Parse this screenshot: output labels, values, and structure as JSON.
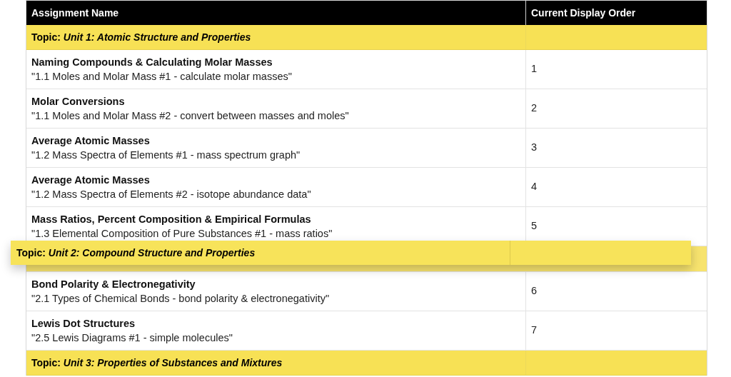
{
  "table": {
    "columns": [
      {
        "label": "Assignment Name"
      },
      {
        "label": "Current Display Order"
      }
    ],
    "rows": [
      {
        "kind": "topic",
        "text": "Topic: *Unit 1: Atomic Structure and Properties*"
      },
      {
        "kind": "assignment",
        "title": "Naming Compounds & Calculating Molar Masses",
        "subtitle": "\"1.1 Moles and Molar Mass #1 - calculate molar masses\"",
        "order": "1"
      },
      {
        "kind": "assignment",
        "title": "Molar Conversions",
        "subtitle": "\"1.1 Moles and Molar Mass #2 - convert between masses and moles\"",
        "order": "2"
      },
      {
        "kind": "assignment",
        "title": "Average Atomic Masses",
        "subtitle": "\"1.2 Mass Spectra of Elements #1 - mass spectrum graph\"",
        "order": "3"
      },
      {
        "kind": "assignment",
        "title": "Average Atomic Masses",
        "subtitle": "\"1.2 Mass Spectra of Elements #2 - isotope abundance data\"",
        "order": "4"
      },
      {
        "kind": "assignment",
        "title": "Mass Ratios, Percent Composition & Empirical Formulas",
        "subtitle": "\"1.3 Elemental Composition of Pure Substances #1 - mass ratios\"",
        "order": "5"
      },
      {
        "kind": "placeholder"
      },
      {
        "kind": "assignment",
        "title": "Bond Polarity & Electronegativity",
        "subtitle": "\"2.1 Types of Chemical Bonds - bond polarity & electronegativity\"",
        "order": "6"
      },
      {
        "kind": "assignment",
        "title": "Lewis Dot Structures",
        "subtitle": "\"2.5 Lewis Diagrams #1 - simple molecules\"",
        "order": "7"
      },
      {
        "kind": "topic",
        "text": "Topic: *Unit 3: Properties of Substances and Mixtures*"
      }
    ]
  },
  "drag_overlay": {
    "kind": "topic",
    "text": "Topic: *Unit 2: Compound Structure and Properties*"
  }
}
